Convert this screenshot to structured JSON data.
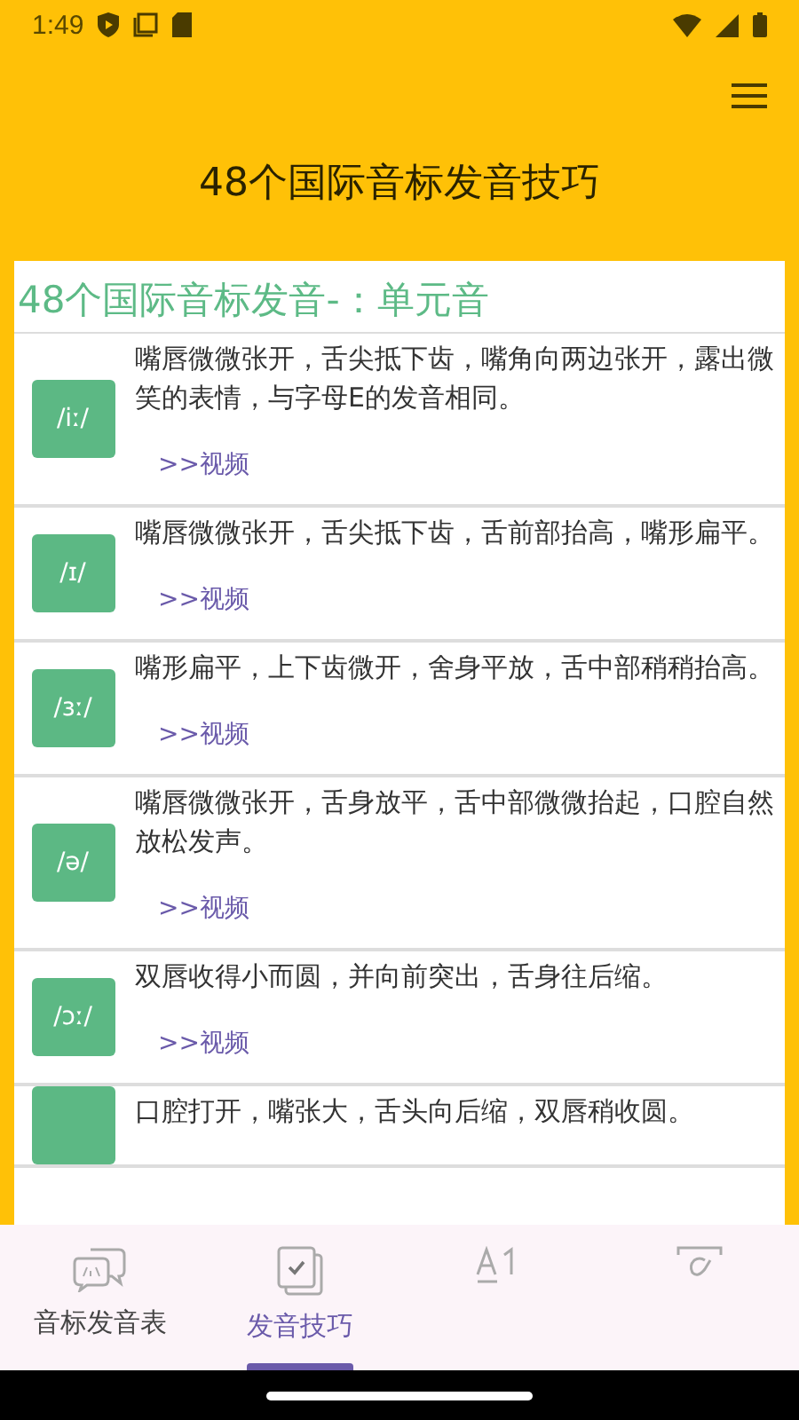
{
  "status_bar": {
    "time": "1:49"
  },
  "app_bar": {
    "title": "48个国际音标发音技巧"
  },
  "section": {
    "heading": "48个国际音标发音-：单元音",
    "items": [
      {
        "symbol": "/iː/",
        "description": "嘴唇微微张开，舌尖抵下齿，嘴角向两边张开，露出微笑的表情，与字母E的发音相同。",
        "link": ">>视频"
      },
      {
        "symbol": "/ɪ/",
        "description": "嘴唇微微张开，舌尖抵下齿，舌前部抬高，嘴形扁平。",
        "link": ">>视频"
      },
      {
        "symbol": "/ɜː/",
        "description": "嘴形扁平，上下齿微开，舍身平放，舌中部稍稍抬高。",
        "link": ">>视频"
      },
      {
        "symbol": "/ə/",
        "description": "嘴唇微微张开，舌身放平，舌中部微微抬起，口腔自然放松发声。",
        "link": ">>视频"
      },
      {
        "symbol": "/ɔː/",
        "description": "双唇收得小而圆，并向前突出，舌身往后缩。",
        "link": ">>视频"
      },
      {
        "description": "口腔打开，嘴张大，舌头向后缩，双唇稍收圆。"
      }
    ]
  },
  "bottom_nav": [
    {
      "kind": "chat",
      "label": "音标发音表",
      "selected": false
    },
    {
      "kind": "check",
      "label": "发音技巧",
      "selected": true
    },
    {
      "kind": "letters",
      "selected": false
    },
    {
      "kind": "alpha",
      "selected": false
    }
  ]
}
